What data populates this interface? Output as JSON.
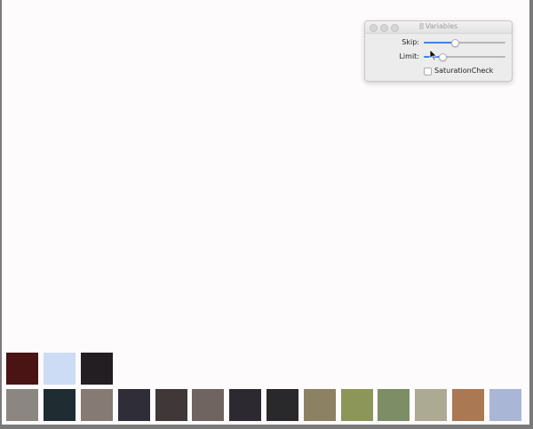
{
  "window": {
    "title": "Variables"
  },
  "controls": {
    "skip": {
      "label": "Skip:",
      "value": 0.38
    },
    "limit": {
      "label": "Limit:",
      "value": 0.23
    },
    "saturation_check": {
      "label": "SaturationCheck",
      "checked": false
    }
  },
  "palette": {
    "top_row": [
      "#4a1414",
      "#ccdcf4",
      "#231e22"
    ],
    "bottom_row": [
      "#8c8683",
      "#1f2c32",
      "#857a74",
      "#2f2d38",
      "#403838",
      "#706461",
      "#2c2a30",
      "#29292c",
      "#8d8163",
      "#8d9659",
      "#7d8d65",
      "#adaa94",
      "#aa7853",
      "#a9b6d6"
    ]
  },
  "icons": [
    "close-button",
    "minimize-button",
    "zoom-button",
    "document-icon",
    "cursor-icon"
  ]
}
